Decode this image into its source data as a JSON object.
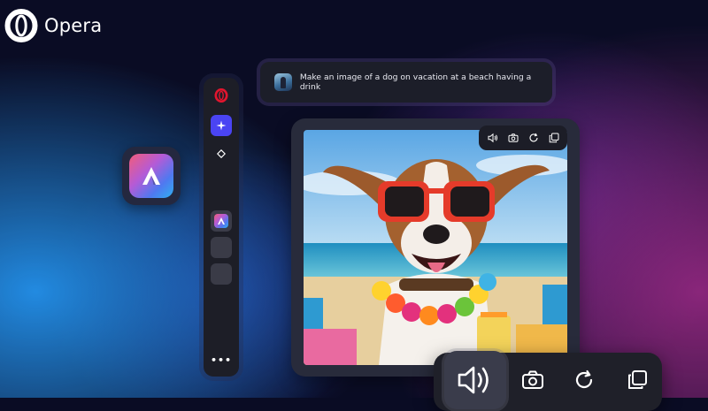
{
  "brand": {
    "name": "Opera"
  },
  "sidebar": {
    "items": [
      {
        "name": "opera-icon"
      },
      {
        "name": "aria-sparkle-icon"
      },
      {
        "name": "diamond-icon"
      },
      {
        "name": "aria-app-icon"
      },
      {
        "name": "empty-slot"
      },
      {
        "name": "empty-slot"
      }
    ],
    "more_label": "•••"
  },
  "prompt": {
    "text": "Make an image of a dog on vacation at a beach having a drink"
  },
  "image_toolbar": {
    "icons": [
      "speaker-icon",
      "camera-icon",
      "regenerate-icon",
      "copy-icon"
    ]
  },
  "colors": {
    "opera_red": "#e2152e",
    "aria_accent": "#4a44f3",
    "panel": "#1d1e27"
  }
}
